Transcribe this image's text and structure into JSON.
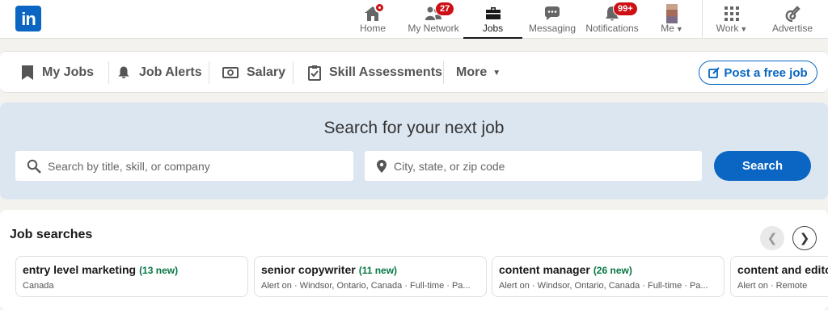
{
  "topnav": {
    "items": [
      {
        "label": "Home",
        "icon": "home-icon"
      },
      {
        "label": "My Network",
        "badge": "27",
        "icon": "network-icon"
      },
      {
        "label": "Jobs",
        "icon": "briefcase-icon"
      },
      {
        "label": "Messaging",
        "icon": "messaging-icon"
      },
      {
        "label": "Notifications",
        "badge": "99+",
        "icon": "bell-icon"
      },
      {
        "label": "Me",
        "icon": "avatar"
      },
      {
        "label": "Work",
        "icon": "grid-icon"
      },
      {
        "label": "Advertise",
        "icon": "advertise-icon"
      }
    ],
    "logo_text": "in"
  },
  "subnav": {
    "my_jobs": "My Jobs",
    "job_alerts": "Job Alerts",
    "salary": "Salary",
    "skill_assessments": "Skill Assessments",
    "more": "More",
    "post_job": "Post a free job"
  },
  "search": {
    "title": "Search for your next job",
    "keyword_placeholder": "Search by title, skill, or company",
    "location_placeholder": "City, state, or zip code",
    "button": "Search"
  },
  "job_searches": {
    "title": "Job searches",
    "cards": [
      {
        "title": "entry level marketing",
        "new": "(13 new)",
        "sub": "Canada"
      },
      {
        "title": "senior copywriter",
        "new": "(11 new)",
        "sub": "Alert on · Windsor, Ontario, Canada · Full-time · Pa..."
      },
      {
        "title": "content manager",
        "new": "(26 new)",
        "sub": "Alert on · Windsor, Ontario, Canada · Full-time · Pa..."
      },
      {
        "title": "content and editor",
        "new": "",
        "sub": "Alert on · Remote"
      }
    ]
  },
  "colors": {
    "brand": "#0a66c2",
    "badge": "#cc1016",
    "new": "#057642",
    "banner": "#dce6f1"
  }
}
